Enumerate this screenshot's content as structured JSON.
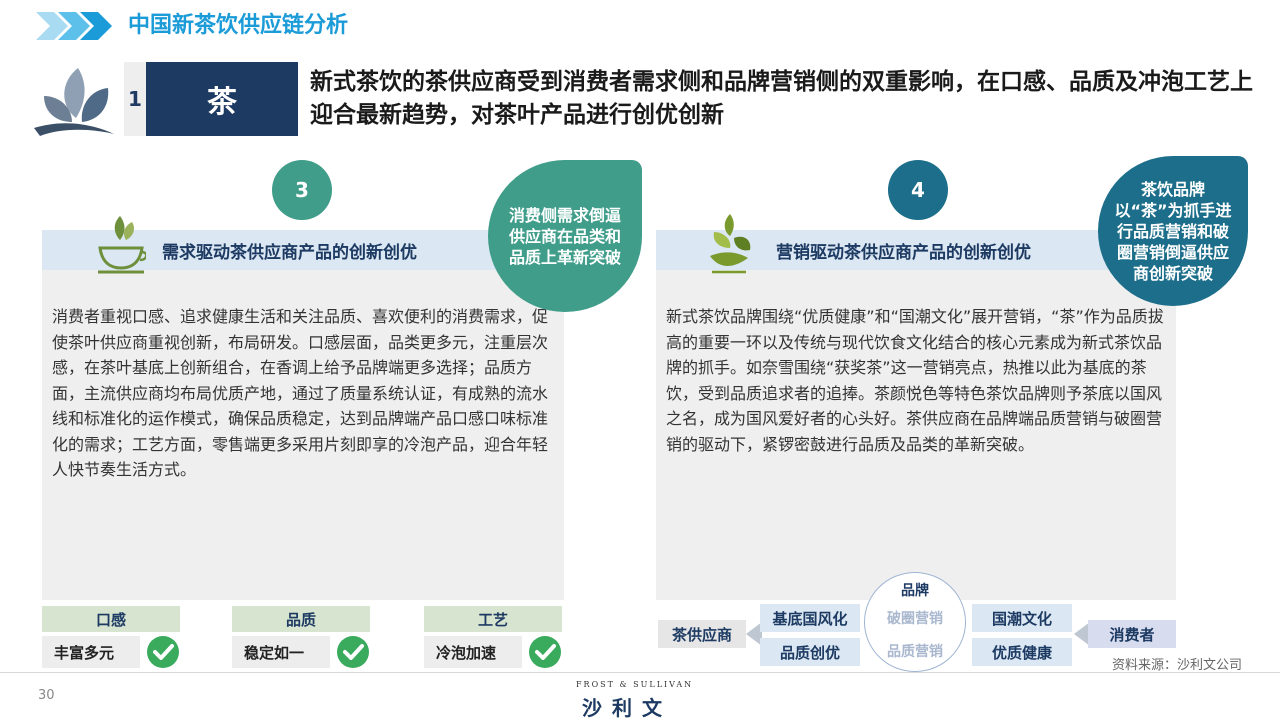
{
  "header": {
    "title": "中国新茶饮供应链分析"
  },
  "section": {
    "number": "1",
    "label": "茶",
    "headline": "新式茶饮的茶供应商受到消费者需求侧和品牌营销侧的双重影响，在口感、品质及冲泡工艺上迎合最新趋势，对茶叶产品进行创优创新"
  },
  "left_panel": {
    "step": "3",
    "title": "需求驱动茶供应商产品的创新创优",
    "bubble": "消费侧需求倒逼供应商在品类和品质上革新突破",
    "body": "消费者重视口感、追求健康生活和关注品质、喜欢便利的消费需求，促使茶叶供应商重视创新，布局研发。口感层面，品类更多元，注重层次感，在茶叶基底上创新组合，在香调上给予品牌端更多选择；品质方面，主流供应商均布局优质产地，通过了质量系统认证，有成熟的流水线和标准化的运作模式，确保品质稳定，达到品牌端产品口感口味标准化的需求；工艺方面，零售端更多采用片刻即享的冷泡产品，迎合年轻人快节奏生活方式。",
    "tags": [
      {
        "head": "口感",
        "value": "丰富多元"
      },
      {
        "head": "品质",
        "value": "稳定如一"
      },
      {
        "head": "工艺",
        "value": "冷泡加速"
      }
    ]
  },
  "right_panel": {
    "step": "4",
    "title": "营销驱动茶供应商产品的创新创优",
    "bubble": "茶饮品牌以“茶”为抓手进行品质营销和破圈营销倒逼供应商创新突破",
    "body": "新式茶饮品牌围绕“优质健康”和“国潮文化”展开营销，“茶”作为品质拔高的重要一环以及传统与现代饮食文化结合的核心元素成为新式茶饮品牌的抓手。如奈雪围绕“获奖茶”这一营销亮点，热推以此为基底的茶饮，受到品质追求者的追捧。茶颜悦色等特色茶饮品牌则予茶底以国风之名，成为国风爱好者的心头好。茶供应商在品牌端品质营销与破圈营销的驱动下，紧锣密鼓进行品质及品类的革新突破。",
    "flow": {
      "supplier": "茶供应商",
      "left_top": "基底国风化",
      "left_bottom": "品质创优",
      "circle_title": "品牌",
      "circle_a": "破圈营销",
      "circle_b": "品质营销",
      "right_top": "国潮文化",
      "right_bottom": "优质健康",
      "consumer": "消费者"
    }
  },
  "source": "资料来源：沙利文公司",
  "footer": {
    "page": "30",
    "brand_en": "FROST & SULLIVAN",
    "brand_cn": "沙利文"
  },
  "colors": {
    "accent_blue": "#1b9bd7",
    "navy": "#1d3a63",
    "teal": "#3f9d8a",
    "dark_teal": "#1c6e8a",
    "check_green": "#3aaa5c"
  }
}
